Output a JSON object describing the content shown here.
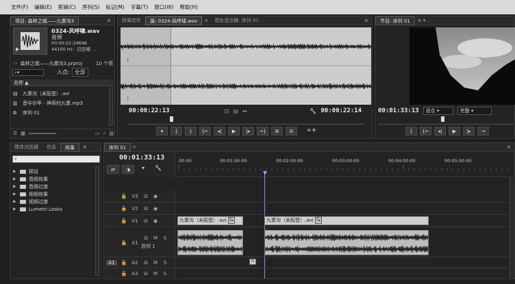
{
  "menu": [
    "文件(F)",
    "编辑(E)",
    "剪辑(C)",
    "序列(S)",
    "标记(M)",
    "字幕(T)",
    "窗口(W)",
    "帮助(H)"
  ],
  "project": {
    "tab_label": "项目: 森林之城——九寨沟3",
    "clip_name": "0324-风呼啸.wav",
    "clip_type": "音频",
    "clip_duration": "00:00:22:24696",
    "clip_format": "44100 Hz - 已压缩 ...",
    "project_file": "森林之城——九寨沟3.prproj",
    "item_count": "10 个项",
    "in_label": "入点:",
    "in_value": "全部",
    "column_name": "名称",
    "items": [
      "九寨沟（未配音）.avi",
      "音中尔甲 - 神奇的九寨.mp3",
      "序列 01"
    ]
  },
  "source": {
    "tabs": [
      "效果控件",
      "源: 0324-风呼啸.wav",
      "音轨混合器: 序列 01"
    ],
    "channel_l": "L",
    "channel_r": "R",
    "marker_glyph": "[",
    "timecode_left": "00:00:22:13",
    "timecode_right": "00:00:22:14",
    "timecode_right_icon": "wrench-icon"
  },
  "program": {
    "tab_label": "节目: 序列 01",
    "timecode": "00:01:33:13",
    "fit_label": "适合",
    "quality_label": "完整"
  },
  "effects": {
    "tabs": [
      "媒体浏览器",
      "信息",
      "效果"
    ],
    "search_placeholder": "",
    "folders": [
      "预设",
      "音频效果",
      "音频过渡",
      "视频效果",
      "视频过渡",
      "Lumetri Looks"
    ]
  },
  "timeline": {
    "tab_label": "序列 01",
    "timecode": "00:01:33:13",
    "ruler": [
      "00:00",
      "00:01:00:00",
      "00:02:00:00",
      "00:03:00:00",
      "00:04:00:00",
      "00:05:00:00"
    ],
    "video_tracks": [
      "V3",
      "V2",
      "V1"
    ],
    "audio_tracks": [
      "A1",
      "A2",
      "A3"
    ],
    "audio_track_name": "音频 1",
    "source_patch": "A1",
    "mute": "M",
    "solo": "S",
    "clip1_label": "九寨沟（未配音）.avi",
    "clip2_label": "九寨沟（未配音）.avi",
    "fx_badge": "fx"
  }
}
